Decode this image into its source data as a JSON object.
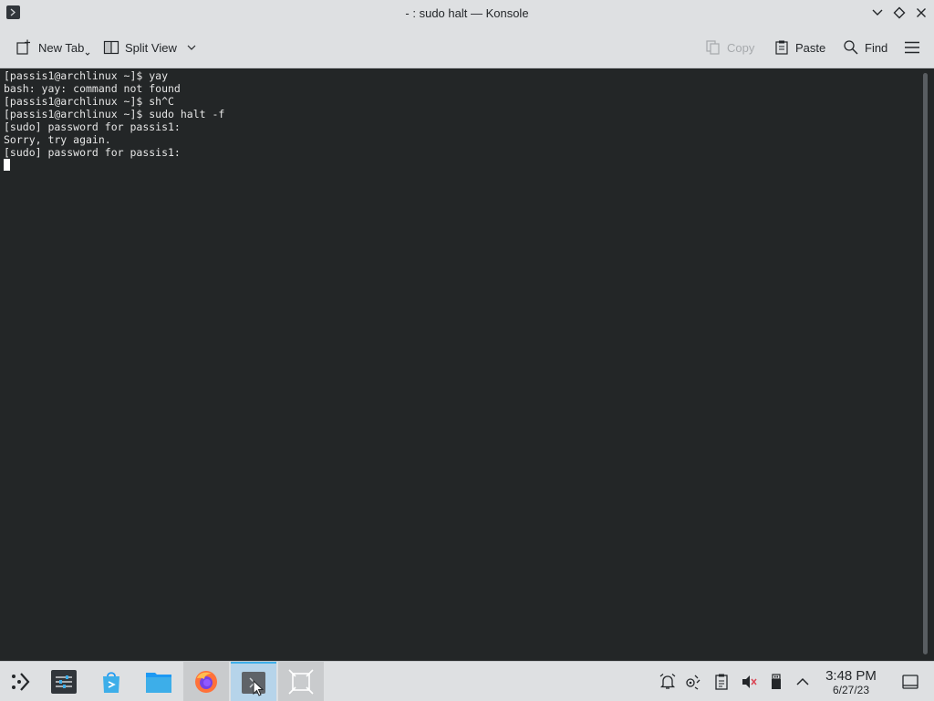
{
  "window": {
    "title": "- : sudo halt — Konsole",
    "icon": "terminal-icon"
  },
  "toolbar": {
    "new_tab_label": "New Tab",
    "split_view_label": "Split View",
    "copy_label": "Copy",
    "paste_label": "Paste",
    "find_label": "Find"
  },
  "terminal": {
    "lines": [
      "[passis1@archlinux ~]$ yay",
      "bash: yay: command not found",
      "[passis1@archlinux ~]$ sh^C",
      "[passis1@archlinux ~]$ sudo halt -f",
      "[sudo] password for passis1:",
      "Sorry, try again.",
      "[sudo] password for passis1:"
    ]
  },
  "taskbar": {
    "apps": [
      "application-launcher-icon",
      "system-settings-icon",
      "discover-store-icon",
      "dolphin-files-icon",
      "firefox-icon",
      "konsole-icon",
      "screenshot-tool-icon"
    ],
    "active_app": "konsole",
    "clock_time": "3:48 PM",
    "clock_date": "6/27/23"
  },
  "colors": {
    "accent": "#3daee9",
    "terminal_bg": "#232627",
    "chrome_bg": "#dee0e2"
  }
}
